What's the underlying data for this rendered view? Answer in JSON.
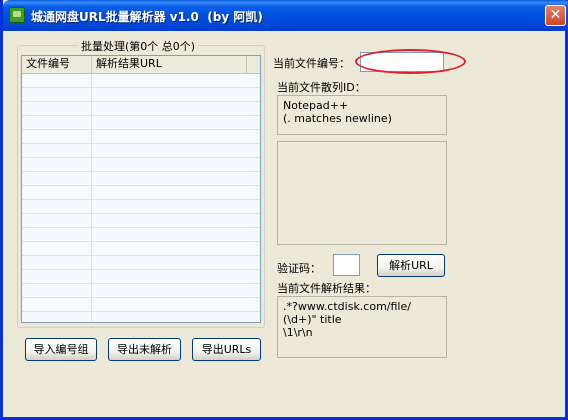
{
  "window": {
    "title": "城通网盘URL批量解析器 v1.0  (by 阿凯)",
    "close_symbol": "✕",
    "icon": "green-disk-icon"
  },
  "batch": {
    "legend": "批量处理(第0个 总0个)",
    "columns": [
      "文件编号",
      "解析结果URL"
    ],
    "rows": []
  },
  "buttons": {
    "import": "导入编号组",
    "export_unparsed": "导出未解析",
    "export_urls": "导出URLs",
    "parse": "解析URL"
  },
  "right": {
    "file_id_label": "当前文件编号：",
    "file_id_value": "",
    "hash_label": "当前文件散列ID：",
    "hash_text": "Notepad++\n(. matches newline)",
    "hash_extra": "",
    "captcha_label": "验证码：",
    "captcha_value": "",
    "result_label": "当前文件解析结果：",
    "result_text": ".*?www.ctdisk.com/file/\n(\\d+)\" title\n\\1\\r\\n"
  },
  "colors": {
    "title_blue": "#0054e3",
    "window_bg": "#ece9d8",
    "annotation_red": "#e0202a"
  }
}
